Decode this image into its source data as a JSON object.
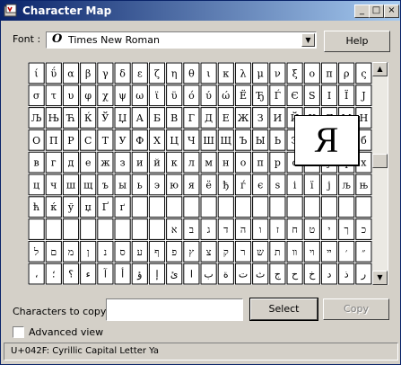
{
  "window": {
    "title": "Character Map",
    "controls": {
      "minimize": "_",
      "maximize": "□",
      "close": "×"
    }
  },
  "font_row": {
    "label": "Font :",
    "selected_font": "Times New Roman",
    "font_icon_glyph": "O",
    "help_label": "Help"
  },
  "grid": {
    "columns": 20,
    "rows": [
      [
        "ί",
        "ΰ",
        "α",
        "β",
        "γ",
        "δ",
        "ε",
        "ζ",
        "η",
        "θ",
        "ι",
        "κ",
        "λ",
        "μ",
        "ν",
        "ξ",
        "ο",
        "π",
        "ρ",
        "ς"
      ],
      [
        "σ",
        "τ",
        "υ",
        "φ",
        "χ",
        "ψ",
        "ω",
        "ϊ",
        "ϋ",
        "ό",
        "ύ",
        "ώ",
        "Ё",
        "Ђ",
        "Ѓ",
        "Є",
        "Ѕ",
        "І",
        "Ї",
        "Ј"
      ],
      [
        "Љ",
        "Њ",
        "Ћ",
        "Ќ",
        "Ў",
        "Џ",
        "А",
        "Б",
        "В",
        "Г",
        "Д",
        "Е",
        "Ж",
        "З",
        "И",
        "Й",
        "К",
        "Л",
        "М",
        "Н"
      ],
      [
        "О",
        "П",
        "Р",
        "С",
        "Т",
        "У",
        "Ф",
        "Х",
        "Ц",
        "Ч",
        "Ш",
        "Щ",
        "Ъ",
        "Ы",
        "Ь",
        "Э",
        "Ю",
        "Я",
        "а",
        "б"
      ],
      [
        "в",
        "г",
        "д",
        "е",
        "ж",
        "з",
        "и",
        "й",
        "к",
        "л",
        "м",
        "н",
        "о",
        "п",
        "р",
        "с",
        "т",
        "у",
        "ф",
        "х"
      ],
      [
        "ц",
        "ч",
        "ш",
        "щ",
        "ъ",
        "ы",
        "ь",
        "э",
        "ю",
        "я",
        "ё",
        "ђ",
        "ѓ",
        "є",
        "ѕ",
        "і",
        "ї",
        "ј",
        "љ",
        "њ"
      ],
      [
        "ћ",
        "ќ",
        "ў",
        "џ",
        "Ґ",
        "ґ",
        "",
        "",
        "",
        "",
        "",
        "",
        "",
        "",
        "",
        "",
        "",
        "",
        "",
        ""
      ],
      [
        "",
        "",
        "",
        "",
        "",
        "",
        "",
        "",
        "א",
        "ב",
        "ג",
        "ד",
        "ה",
        "ו",
        "ז",
        "ח",
        "ט",
        "י",
        "ך",
        "כ"
      ],
      [
        "ל",
        "ם",
        "מ",
        "ן",
        "נ",
        "ס",
        "ע",
        "ף",
        "פ",
        "ץ",
        "צ",
        "ק",
        "ר",
        "ש",
        "ת",
        "װ",
        "ױ",
        "ײ",
        "׳",
        "״"
      ],
      [
        "،",
        "؛",
        "؟",
        "ء",
        "آ",
        "أ",
        "ؤ",
        "إ",
        "ئ",
        "ا",
        "ب",
        "ة",
        "ت",
        "ث",
        "ج",
        "ح",
        "خ",
        "د",
        "ذ",
        "ر"
      ]
    ],
    "selected_char": "Я"
  },
  "copy_row": {
    "label": "Characters to copy :",
    "value": "",
    "select_label": "Select",
    "copy_label": "Copy"
  },
  "advanced": {
    "label": "Advanced view",
    "checked": false
  },
  "status": {
    "text": "U+042F: Cyrillic Capital Letter Ya"
  },
  "colors": {
    "title_gradient_start": "#0a246a",
    "title_gradient_end": "#a6caf0",
    "window_bg": "#d4d0c8"
  }
}
